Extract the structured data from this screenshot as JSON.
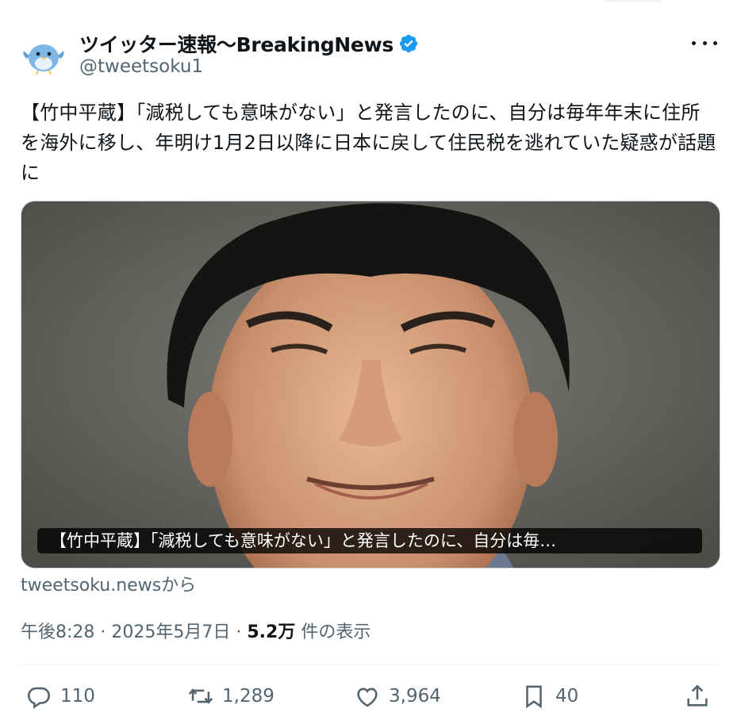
{
  "author": {
    "display_name": "ツイッター速報〜BreakingNews",
    "handle": "@tweetsoku1",
    "verified": true,
    "avatar_icon": "bird-avatar-icon"
  },
  "tweet": {
    "text": "【竹中平蔵】「減税しても意味がない」と発言したのに、自分は毎年年末に住所を海外に移し、年明け1月2日以降に日本に戻して住民税を逃れていた疑惑が話題に",
    "card_caption": "【竹中平蔵】「減税しても意味がない」と発言したのに、自分は毎…",
    "source": "tweetsoku.newsから",
    "time": "午後8:28 · 2025年5月7日 · ",
    "views_count": "5.2万",
    "views_label": " 件の表示"
  },
  "actions": {
    "replies": "110",
    "reposts": "1,289",
    "likes": "3,964",
    "bookmarks": "40"
  },
  "colors": {
    "verified_blue": "#1d9bf0",
    "secondary_text": "#536471",
    "primary_text": "#0f1419"
  }
}
